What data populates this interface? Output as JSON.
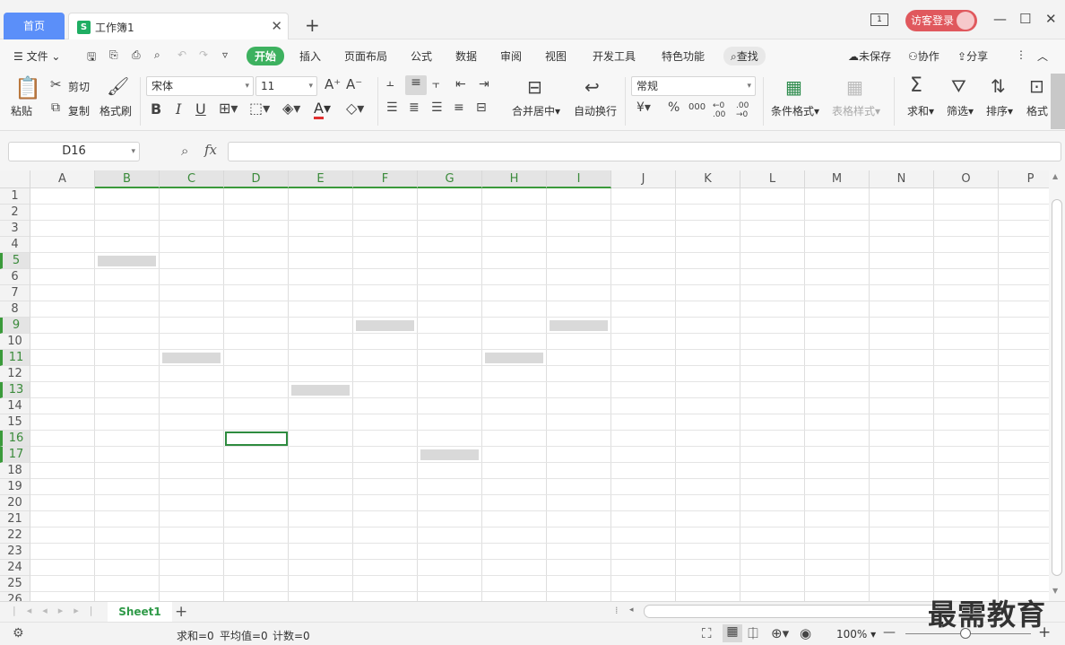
{
  "tabs": {
    "home": "首页",
    "doc": "工作簿1",
    "doc_icon": "S",
    "close": "✕",
    "new": "+"
  },
  "window": {
    "login": "访客登录",
    "minimize": "—",
    "maximize": "☐",
    "close": "✕",
    "page_num": "1"
  },
  "menu": {
    "file": "文件",
    "start": "开始",
    "insert": "插入",
    "layout": "页面布局",
    "formula": "公式",
    "data": "数据",
    "review": "审阅",
    "view": "视图",
    "dev": "开发工具",
    "special": "特色功能",
    "find": "查找",
    "unsaved": "未保存",
    "collab": "协作",
    "share": "分享"
  },
  "toolbar": {
    "paste": "粘贴",
    "cut": "剪切",
    "copy": "复制",
    "format_painter": "格式刷",
    "font": "宋体",
    "size": "11",
    "merge": "合并居中",
    "wrap": "自动换行",
    "number_format": "常规",
    "cond_format": "条件格式",
    "table_style": "表格样式",
    "sum": "求和",
    "filter": "筛选",
    "sort": "排序",
    "format": "格式",
    "bold": "B",
    "italic": "I",
    "underline": "U",
    "currency": "¥",
    "percent": "%",
    "thousands": "000",
    "dec_inc": "←0 .00",
    "dec_dec": ".00 →0"
  },
  "formula": {
    "cell_ref": "D16",
    "fx": "fx",
    "value": ""
  },
  "grid": {
    "columns": [
      "A",
      "B",
      "C",
      "D",
      "E",
      "F",
      "G",
      "H",
      "I",
      "J",
      "K",
      "L",
      "M",
      "N",
      "O",
      "P"
    ],
    "highlighted_columns": [
      "B",
      "C",
      "D",
      "E",
      "F",
      "G",
      "H",
      "I"
    ],
    "rows": [
      "1",
      "2",
      "3",
      "4",
      "5",
      "6",
      "7",
      "8",
      "9",
      "10",
      "11",
      "12",
      "13",
      "14",
      "15",
      "16",
      "17",
      "18",
      "19",
      "20",
      "21",
      "22",
      "23",
      "24",
      "25",
      "26"
    ],
    "highlighted_rows": [
      "5",
      "9",
      "11",
      "13",
      "16",
      "17"
    ],
    "active_cell": "D16",
    "filled_cells": [
      "B5",
      "F9",
      "I9",
      "C11",
      "H11",
      "E13",
      "G17"
    ]
  },
  "sheets": {
    "active": "Sheet1",
    "add": "+"
  },
  "status": {
    "sum": "求和=0",
    "avg": "平均值=0",
    "count": "计数=0",
    "zoom": "100%",
    "zoom_minus": "—",
    "zoom_plus": "+"
  },
  "watermark": "最需教育"
}
